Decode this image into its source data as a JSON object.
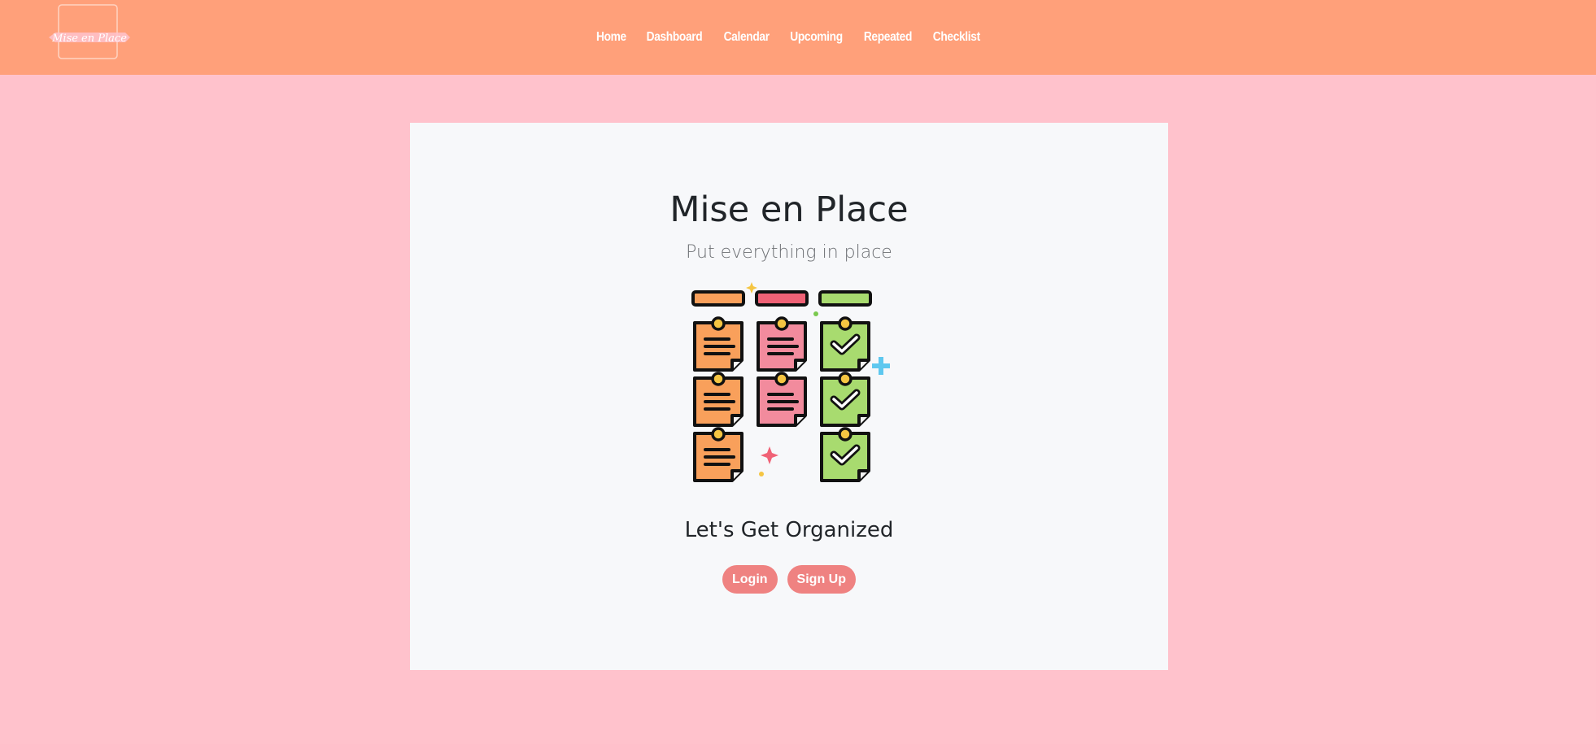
{
  "header": {
    "logo_text": "Mise en Place",
    "nav": [
      {
        "label": "Home"
      },
      {
        "label": "Dashboard"
      },
      {
        "label": "Calendar"
      },
      {
        "label": "Upcoming"
      },
      {
        "label": "Repeated"
      },
      {
        "label": "Checklist"
      }
    ]
  },
  "hero": {
    "title": "Mise en Place",
    "subtitle": "Put everything in place",
    "illustration_icon": "sticky-notes-board-icon",
    "tagline": "Let's Get Organized",
    "login_label": "Login",
    "signup_label": "Sign Up"
  },
  "colors": {
    "navbar": "#ffa07a",
    "page_background": "#ffc2cc",
    "card_background": "#f7f8fa",
    "button": "#ef8281",
    "note_orange": "#f9a05b",
    "note_pink": "#f28b9d",
    "note_green": "#a8db6f"
  }
}
